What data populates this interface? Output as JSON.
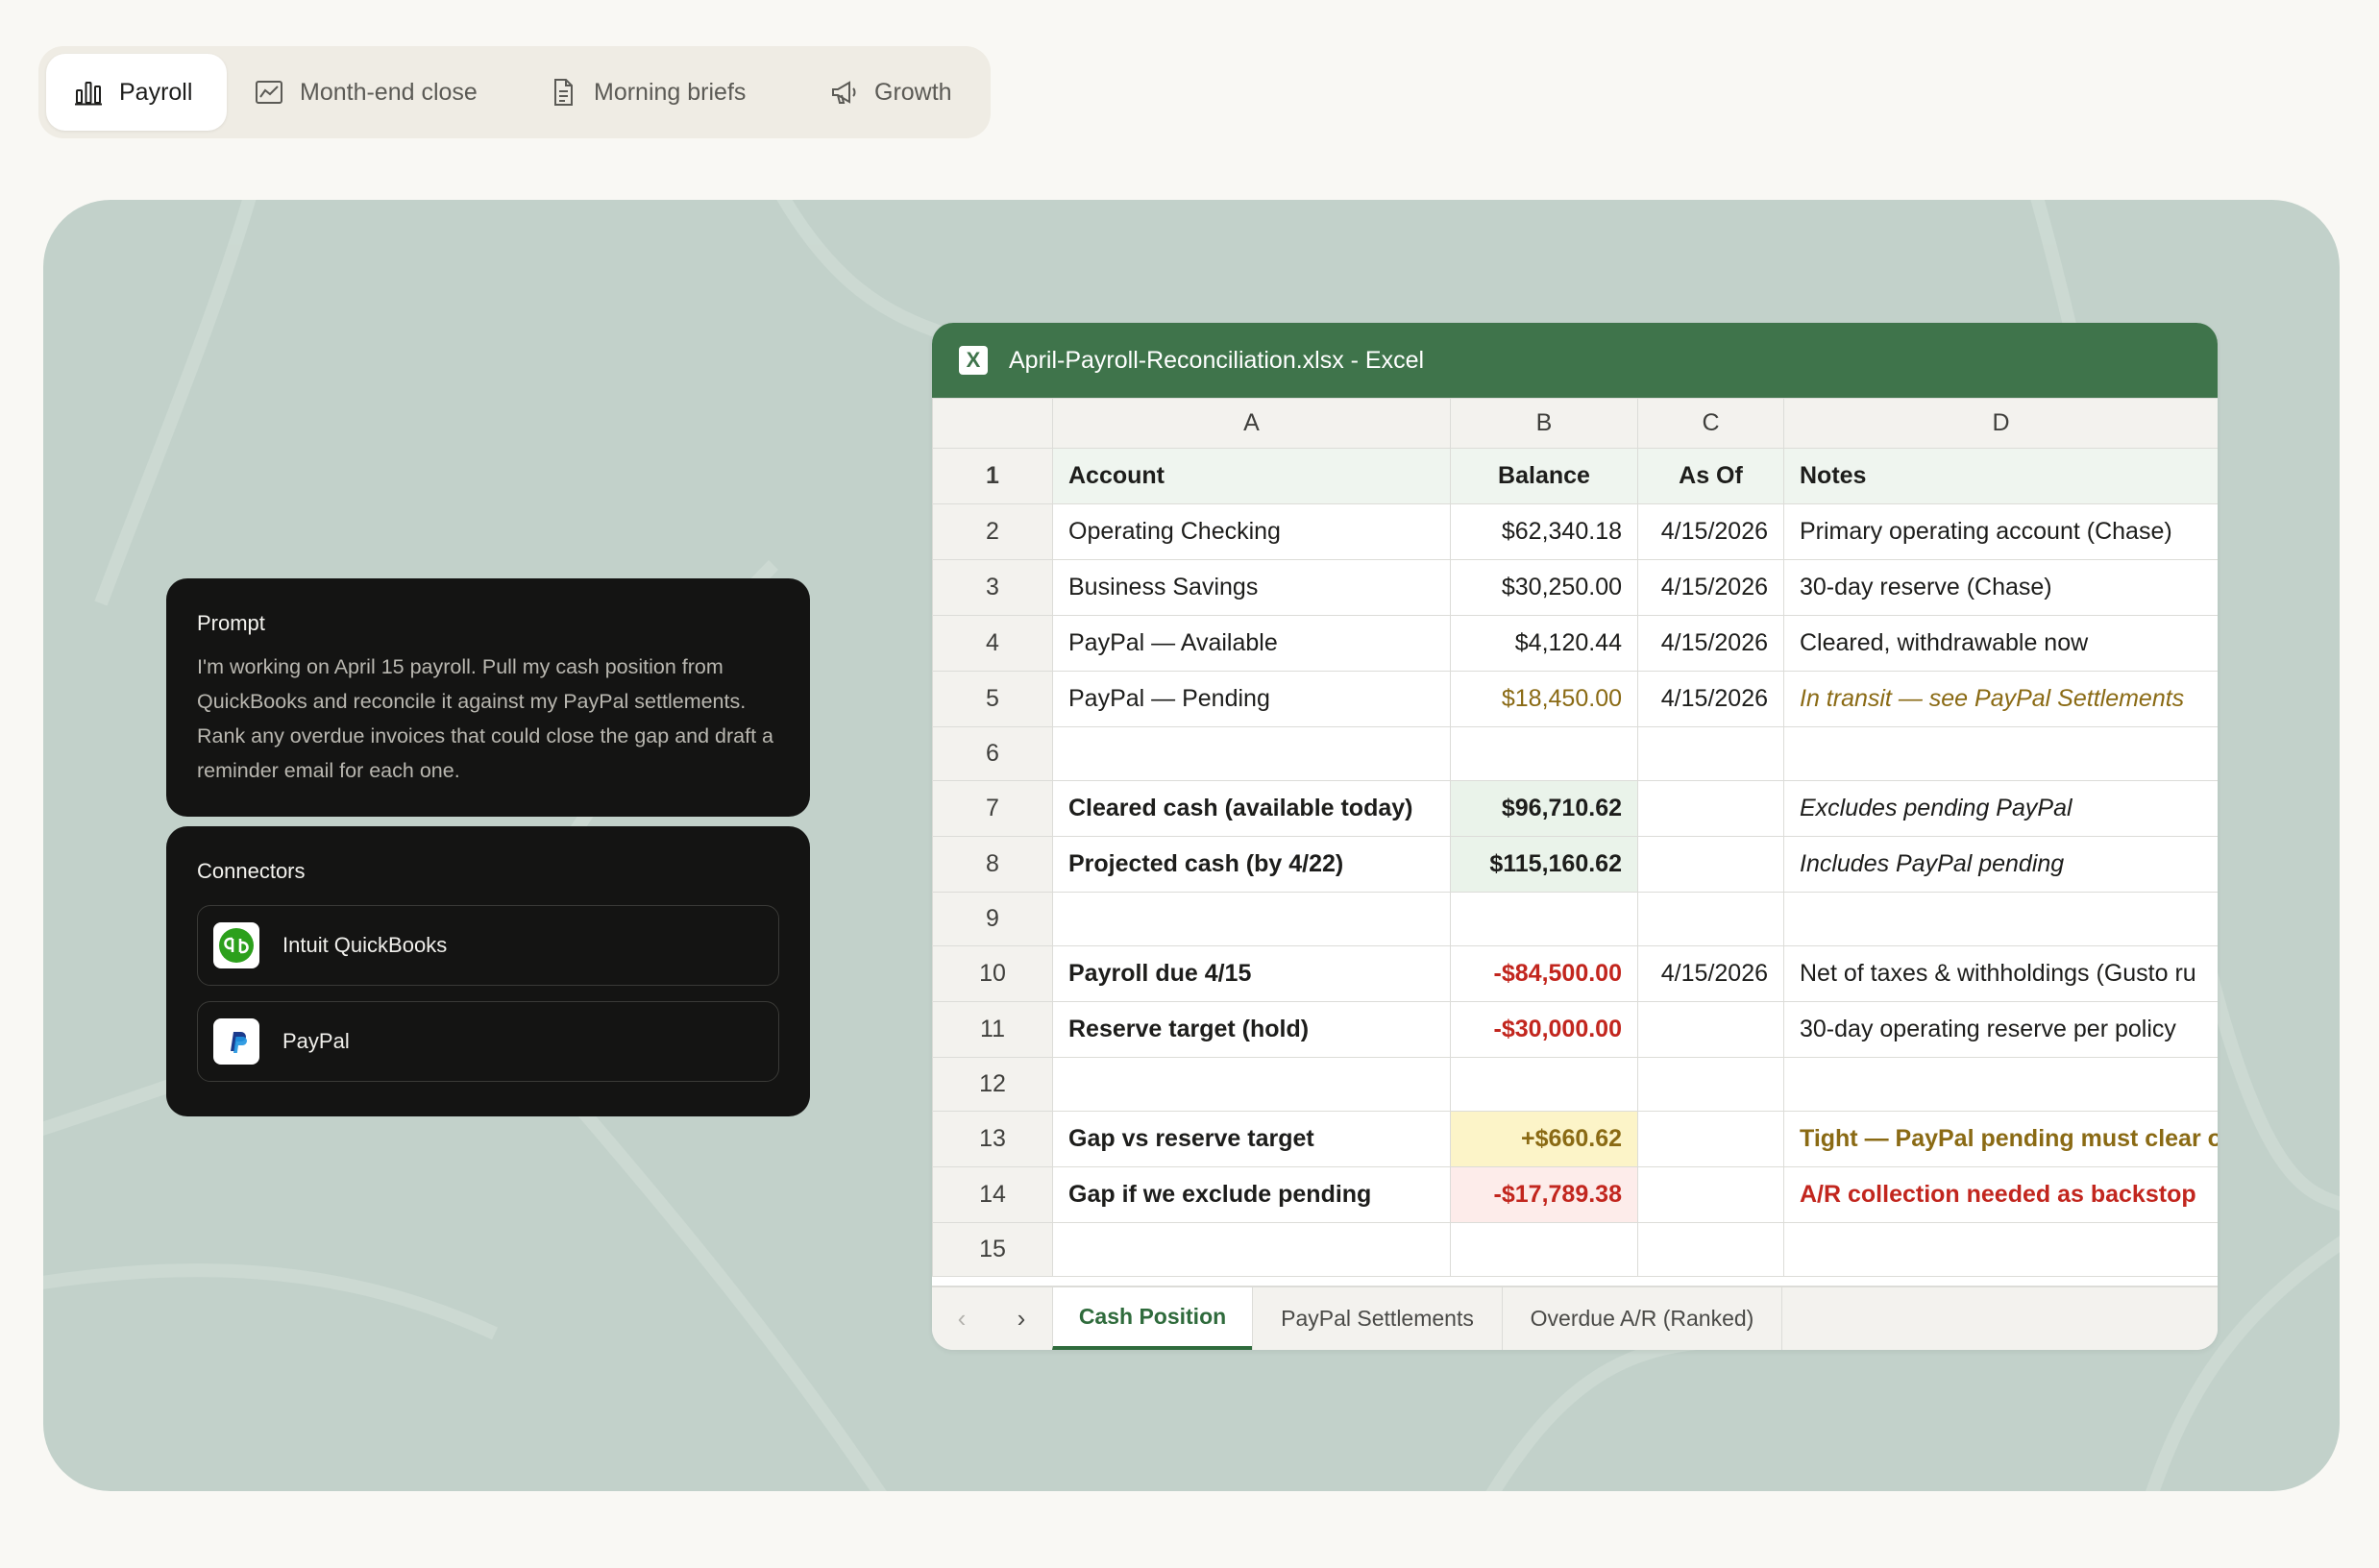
{
  "tabs": [
    {
      "label": "Payroll",
      "icon": "bar-chart-icon"
    },
    {
      "label": "Month-end close",
      "icon": "line-chart-icon"
    },
    {
      "label": "Morning briefs",
      "icon": "document-icon"
    },
    {
      "label": "Growth",
      "icon": "megaphone-icon"
    }
  ],
  "prompt": {
    "title": "Prompt",
    "text": "I'm working on April 15 payroll. Pull my cash position from QuickBooks and reconcile it against my PayPal settlements. Rank any overdue invoices that could close the gap and draft a reminder email for each one."
  },
  "connectors": {
    "title": "Connectors",
    "items": [
      {
        "label": "Intuit QuickBooks",
        "icon": "quickbooks-logo-icon"
      },
      {
        "label": "PayPal",
        "icon": "paypal-logo-icon"
      }
    ]
  },
  "excel": {
    "title": "April-Payroll-Reconciliation.xlsx - Excel",
    "app_icon_letter": "X",
    "columns": [
      "A",
      "B",
      "C",
      "D"
    ],
    "rows": [
      {
        "n": "1",
        "a": "Account",
        "b": "Balance",
        "c": "As Of",
        "d": "Notes"
      },
      {
        "n": "2",
        "a": "Operating Checking",
        "b": "$62,340.18",
        "c": "4/15/2026",
        "d": "Primary operating account (Chase)"
      },
      {
        "n": "3",
        "a": "Business Savings",
        "b": "$30,250.00",
        "c": "4/15/2026",
        "d": "30-day reserve (Chase)"
      },
      {
        "n": "4",
        "a": "PayPal — Available",
        "b": "$4,120.44",
        "c": "4/15/2026",
        "d": "Cleared, withdrawable now"
      },
      {
        "n": "5",
        "a": "PayPal — Pending",
        "b": "$18,450.00",
        "c": "4/15/2026",
        "d": "In transit — see PayPal Settlements"
      },
      {
        "n": "6",
        "a": "",
        "b": "",
        "c": "",
        "d": ""
      },
      {
        "n": "7",
        "a": "Cleared cash (available today)",
        "b": "$96,710.62",
        "c": "",
        "d": "Excludes pending PayPal"
      },
      {
        "n": "8",
        "a": "Projected cash (by 4/22)",
        "b": "$115,160.62",
        "c": "",
        "d": "Includes PayPal pending"
      },
      {
        "n": "9",
        "a": "",
        "b": "",
        "c": "",
        "d": ""
      },
      {
        "n": "10",
        "a": "Payroll due 4/15",
        "b": "-$84,500.00",
        "c": "4/15/2026",
        "d": "Net of taxes & withholdings (Gusto ru"
      },
      {
        "n": "11",
        "a": "Reserve target (hold)",
        "b": "-$30,000.00",
        "c": "",
        "d": "30-day operating reserve per policy"
      },
      {
        "n": "12",
        "a": "",
        "b": "",
        "c": "",
        "d": ""
      },
      {
        "n": "13",
        "a": "Gap vs reserve target",
        "b": "+$660.62",
        "c": "",
        "d": "Tight — PayPal pending must clear o"
      },
      {
        "n": "14",
        "a": "Gap if we exclude pending",
        "b": "-$17,789.38",
        "c": "",
        "d": "A/R collection needed as backstop"
      },
      {
        "n": "15",
        "a": "",
        "b": "",
        "c": "",
        "d": ""
      }
    ],
    "sheets": [
      "Cash Position",
      "PayPal Settlements",
      "Overdue A/R (Ranked)"
    ],
    "active_sheet": "Cash Position"
  },
  "colors": {
    "excel_green": "#3f744b",
    "stage_bg": "#c2d1ca",
    "negative_red": "#c2261e",
    "pending_gold": "#8a6a14"
  }
}
